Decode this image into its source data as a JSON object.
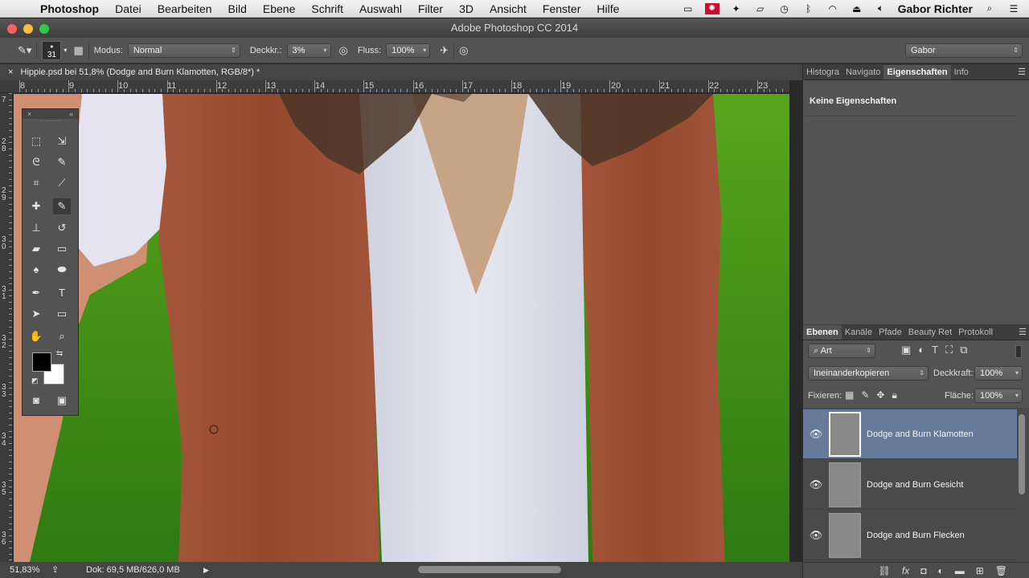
{
  "menubar": {
    "app": "Photoshop",
    "items": [
      "Datei",
      "Bearbeiten",
      "Bild",
      "Ebene",
      "Schrift",
      "Auswahl",
      "Filter",
      "3D",
      "Ansicht",
      "Fenster",
      "Hilfe"
    ],
    "user": "Gabor Richter"
  },
  "window": {
    "title": "Adobe Photoshop CC 2014"
  },
  "options": {
    "brush_size": "31",
    "mode_label": "Modus:",
    "mode_value": "Normal",
    "opacity_label": "Deckkr.:",
    "opacity_value": "3%",
    "flow_label": "Fluss:",
    "flow_value": "100%",
    "workspace": "Gabor"
  },
  "document": {
    "tab_title": "Hippie.psd bei 51,8% (Dodge and Burn Klamotten, RGB/8*) *"
  },
  "rulers": {
    "h_labels": [
      "8",
      "9",
      "10",
      "11",
      "12",
      "13",
      "14",
      "15",
      "16",
      "17",
      "18",
      "19",
      "20",
      "21",
      "22",
      "23"
    ],
    "v_labels": [
      "7",
      "2 8",
      "2 9",
      "3 0",
      "3 1",
      "3 2",
      "3 3",
      "3 4",
      "3 5",
      "3 6"
    ]
  },
  "status": {
    "zoom": "51,83%",
    "doc_size": "Dok: 69,5 MB/626,0 MB"
  },
  "properties_panel": {
    "tabs": [
      "Histogra",
      "Navigato",
      "Eigenschaften",
      "Info"
    ],
    "active_tab": "Eigenschaften",
    "content": "Keine Eigenschaften"
  },
  "layers_panel": {
    "tabs": [
      "Ebenen",
      "Kanäle",
      "Pfade",
      "Beauty Ret",
      "Protokoll"
    ],
    "active_tab": "Ebenen",
    "filter_label": "Art",
    "blend_mode": "Ineinanderkopieren",
    "opacity_label": "Deckkraft:",
    "opacity_value": "100%",
    "lock_label": "Fixieren:",
    "fill_label": "Fläche:",
    "fill_value": "100%",
    "layers": [
      {
        "name": "Dodge and Burn Klamotten",
        "selected": true
      },
      {
        "name": "Dodge and Burn Gesicht",
        "selected": false
      },
      {
        "name": "Dodge and Burn Flecken",
        "selected": false
      }
    ]
  },
  "colors": {
    "accent_selection": "#667b99",
    "panel_bg": "#535353",
    "green_screen": "#3e8a16",
    "vest_brown": "#9a4a2c",
    "shirt_white": "#dcdde8"
  }
}
